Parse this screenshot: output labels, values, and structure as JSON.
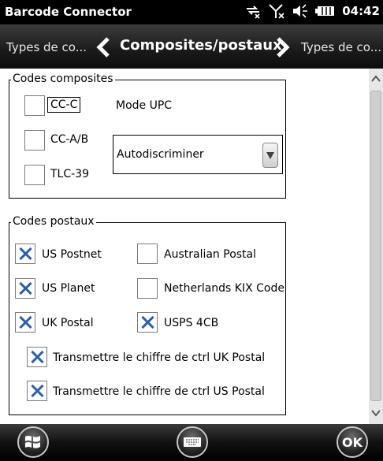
{
  "statusbar": {
    "app_title": "Barcode Connector",
    "time": "04:42",
    "icons": [
      "sync-icon",
      "no-signal-icon",
      "volume-icon",
      "battery-icon"
    ]
  },
  "navbar": {
    "prev_label": "Types de co...",
    "current_label": "Composites/postaux",
    "next_label": "Types de co..."
  },
  "composite_group": {
    "title": "Codes composites",
    "items": [
      {
        "label": "CC-C",
        "checked": false
      },
      {
        "label": "CC-A/B",
        "checked": false
      },
      {
        "label": "TLC-39",
        "checked": false
      }
    ],
    "upc_mode_label": "Mode UPC",
    "upc_mode_value": "Autodiscriminer"
  },
  "postal_group": {
    "title": "Codes postaux",
    "items": [
      {
        "label": "US Postnet",
        "checked": true
      },
      {
        "label": "Australian Postal",
        "checked": false
      },
      {
        "label": "US Planet",
        "checked": true
      },
      {
        "label": "Netherlands KIX Code",
        "checked": false
      },
      {
        "label": "UK Postal",
        "checked": true
      },
      {
        "label": "USPS 4CB",
        "checked": true
      },
      {
        "label": "Transmettre le chiffre de ctrl UK Postal",
        "checked": true
      },
      {
        "label": "Transmettre le chiffre de ctrl US Postal",
        "checked": true
      }
    ]
  },
  "bottombar": {
    "ok_label": "OK",
    "start_icon": "windows-start-icon",
    "keyboard_icon": "keyboard-icon"
  },
  "colors": {
    "check_mark": "#2d5ea6",
    "bar_background": "#000000"
  }
}
